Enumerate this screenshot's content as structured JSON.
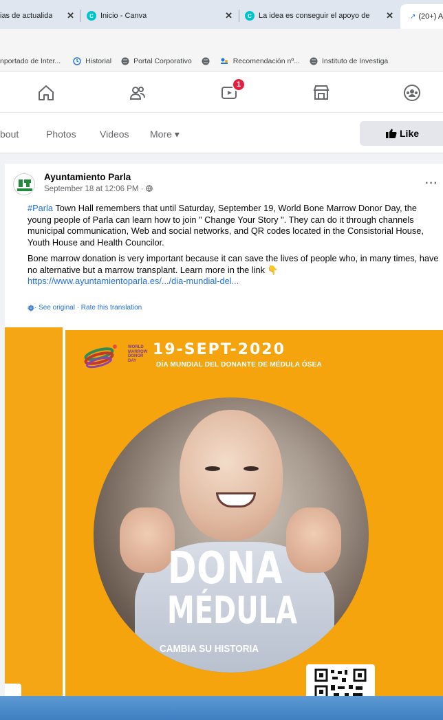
{
  "browser": {
    "tabs": [
      {
        "label": "ias de actualida",
        "closable": true
      },
      {
        "label": "Inicio - Canva",
        "closable": true
      },
      {
        "label": "La idea es conseguir el apoyo de",
        "closable": true
      },
      {
        "label": "(20+) A",
        "active": true
      }
    ],
    "bookmarks": [
      {
        "label": "nportado de Inter..."
      },
      {
        "label": "Historial"
      },
      {
        "label": "Portal Corporativo"
      },
      {
        "label": ""
      },
      {
        "label": "Recomendación nº..."
      },
      {
        "label": "Instituto de Investiga"
      }
    ]
  },
  "fb_nav": {
    "icons": [
      "home-icon",
      "friends-icon",
      "watch-icon",
      "marketplace-icon",
      "groups-icon"
    ],
    "watch_badge": "1"
  },
  "page_tabs": {
    "items": [
      "bout",
      "Photos",
      "Videos",
      "More ▾"
    ],
    "like_label": "Like"
  },
  "post": {
    "author": "Ayuntamiento Parla",
    "timestamp": "September 18 at 12:06 PM · ",
    "hashtag": "#Parla",
    "paragraph1_rest": " Town Hall remembers that until Saturday, September 19, World Bone Marrow Donor Day, the young people of Parla can learn how to join \" Change Your Story \". They can do it through channels municipal communication, Web and social networks, and QR codes located in the Consistorial House, Youth House and Health Councilor.",
    "paragraph2": "Bone marrow donation is very important because it can save the lives of people who, in many times, have no alternative but a marrow transplant. Learn more in the link 👇",
    "link": "https://www.ayuntamientoparla.es/.../dia-mundial-del...",
    "see_original": " · See original · Rate this translation",
    "more_dots": "···"
  },
  "poster": {
    "logo_text": "WORLD\nMARROW\nDONOR\nDAY",
    "date": "19-SEPT-2020",
    "subtitle": "DÍA MUNDIAL DEL DONANTE DE MÉDULA ÓSEA",
    "headline1": "DONA",
    "headline2": "MÉDULA",
    "tagline": "CAMBIA SU HISTORIA"
  },
  "colors": {
    "poster_bg": "#f4a615",
    "fb_blue": "#216fdb",
    "badge_red": "#e41e3f"
  }
}
